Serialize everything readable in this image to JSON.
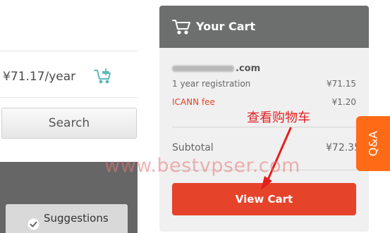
{
  "left": {
    "price": "¥71.17/year",
    "search_label": "Search",
    "suggestions_label": "Suggestions"
  },
  "cart": {
    "title": "Your Cart",
    "domain_suffix": ".com",
    "items": [
      {
        "label": "1 year registration",
        "price": "¥71.15"
      },
      {
        "label": "ICANN fee",
        "price": "¥1.20"
      }
    ],
    "subtotal_label": "Subtotal",
    "subtotal_value": "¥72.35",
    "view_cart_label": "View Cart"
  },
  "annotation": {
    "text": "查看购物车"
  },
  "watermark": "www.bestvpser.com",
  "qa_tab": {
    "label": "Q&A"
  },
  "colors": {
    "cart_header": "#6d6e6e",
    "cart_body": "#f0f0f0",
    "primary_button": "#e6432b",
    "fee_text": "#e2432a",
    "qa_tab": "#ff6a16",
    "annotation": "#e51f1f",
    "add_cart_icon": "#5fb8b8"
  },
  "icons": {
    "add_to_cart": "add-to-cart-icon",
    "cart": "shopping-cart-icon",
    "suggestions": "check-circle-icon"
  }
}
